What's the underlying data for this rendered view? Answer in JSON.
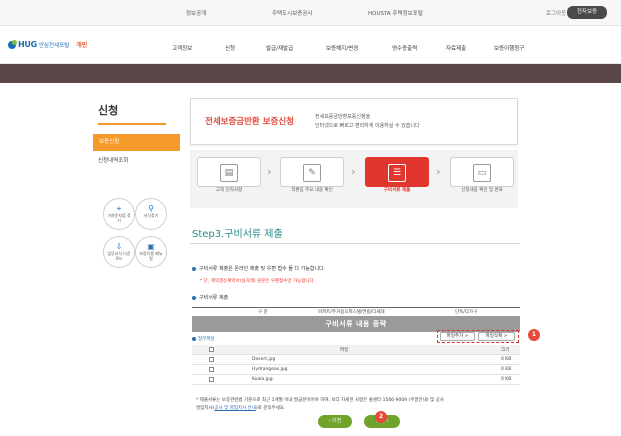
{
  "topbar": {
    "links": [
      "정보공개",
      "주택도시보증공사",
      "HOUSTA 주택정보포털"
    ],
    "login": "로그아웃",
    "join": "전자보증"
  },
  "header": {
    "logo_text": "HUG",
    "logo_sub": "안심전세포털",
    "personal": "개인",
    "menu": [
      "고객정보",
      "신청",
      "발급/재발급",
      "보증해지/변경",
      "영수증출력",
      "자료제출",
      "보증이행청구"
    ]
  },
  "sidebar": {
    "title": "신청",
    "items": [
      "보증신청",
      "신청내역조회"
    ],
    "quick": [
      {
        "icon": "location-pin-icon",
        "label": "가까운지점 찾기"
      },
      {
        "icon": "search-icon",
        "label": "서식찾기"
      },
      {
        "icon": "download-icon",
        "label": "업무서식 다운로드"
      },
      {
        "icon": "book-icon",
        "label": "보증이용 매뉴얼"
      }
    ]
  },
  "intro": {
    "title": "전세보증금반환 보증신청",
    "desc1": "전세보증금반환보증신청을",
    "desc2": "인터넷으로 빠르고 편리하게 이용하실 수 있습니다"
  },
  "steps": [
    {
      "label": "고객 인적사항",
      "active": false,
      "icon": "id-card-icon"
    },
    {
      "label": "적편입 주요 내용 확인",
      "active": false,
      "icon": "document-icon"
    },
    {
      "label": "구비서류 제출",
      "active": true,
      "icon": "form-icon"
    },
    {
      "label": "신청내용 확인 및 완료",
      "active": false,
      "icon": "monitor-icon"
    }
  ],
  "content": {
    "step_title": "Step3.구비서류 제출",
    "bullet1": "구비서류 제출은 온라인 제출 및 우편 접수 둘 다 가능합니다.",
    "note_red": "* 단, 계약갱신계약서(실거래) 원본은 우편접수만 가능합니다.",
    "bullet2": "구비서류 제출"
  },
  "doc_table": {
    "headers": [
      "구 분",
      "아파트/주거용오피스텔/연립/다세대",
      "단독/다가구"
    ],
    "banner": "구비서류 내용 중략"
  },
  "attachments": {
    "label": "첨부파일",
    "add_button": "파일추가 >",
    "delete_button": "파일삭제 >",
    "col_file": "파일",
    "col_size": "크기",
    "files": [
      {
        "name": "Desert.jpg",
        "size": "0 KB"
      },
      {
        "name": "Hydrangeas.jpg",
        "size": "0 KB"
      },
      {
        "name": "Koala.jpg",
        "size": "0 KB"
      }
    ]
  },
  "notice": {
    "line1": "* 제출서류는 보증관련법 기준으로 최근 1개월 이내 발급분이어야 하며, 보다 자세한 사항은 콜센터 1566-9009 (주말안내) 및 공사",
    "line2_prefix": "영업지사(",
    "line2_link": "공사 및 영업지사 안내",
    "line2_suffix": ")로 문의주세요."
  },
  "nav": {
    "prev": "‹ 이전",
    "next": "다음 ›"
  },
  "markers": [
    "1",
    "2"
  ],
  "colors": {
    "accent": "#f59a2a",
    "active_step": "#e0362d",
    "band": "#5b4747",
    "button": "#6fa329",
    "link": "#2a6fb3"
  }
}
